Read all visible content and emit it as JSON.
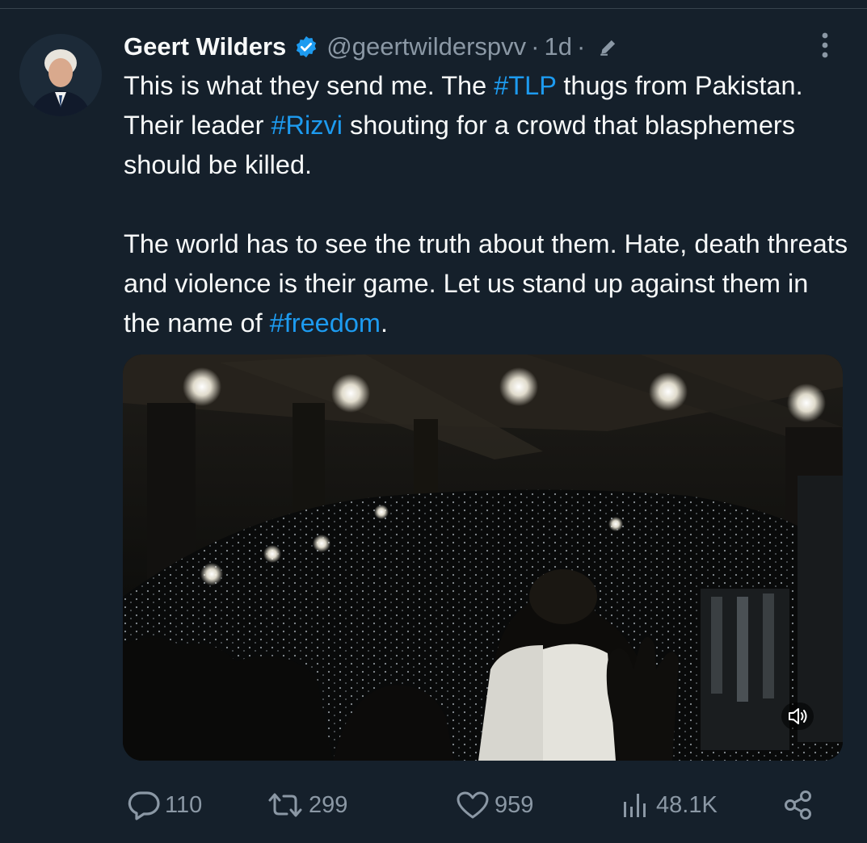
{
  "tweet": {
    "author_name": "Geert Wilders",
    "handle": "@geertwilderspvv",
    "separator": "·",
    "timestamp": "1d",
    "paragraph1": {
      "part1": "This is what they send me. The ",
      "hashtag1": "#TLP",
      "part2": " thugs from Pakistan. Their leader ",
      "hashtag2": "#Rizvi",
      "part3": " shouting for a crowd that blasphemers should be killed."
    },
    "paragraph2": {
      "part1": "The world has to see the truth about them. Hate, death threats and violence is their game. Let us stand up against them in the name of ",
      "hashtag": "#freedom",
      "part2": "."
    }
  },
  "actions": {
    "replies": "110",
    "reposts": "299",
    "likes": "959",
    "views": "48.1K"
  },
  "icons": {
    "verified": "verified-badge-icon",
    "edited": "pencil-edit-icon",
    "more": "more-vertical-icon",
    "reply": "reply-bubble-icon",
    "repost": "repost-icon",
    "like": "heart-icon",
    "views": "views-bar-icon",
    "share": "share-icon",
    "volume": "speaker-icon"
  },
  "colors": {
    "background": "#15202b",
    "text": "#f7f9f9",
    "secondary": "#8b98a5",
    "accent": "#1d9bf0"
  }
}
